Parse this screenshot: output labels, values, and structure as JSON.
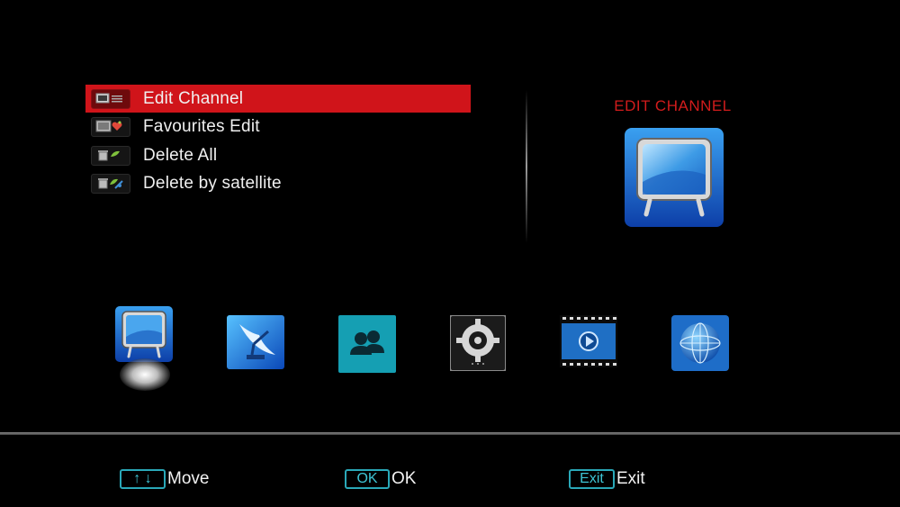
{
  "menu": {
    "items": [
      {
        "label": "Edit Channel",
        "icon": "tv-list-icon",
        "selected": true
      },
      {
        "label": "Favourites Edit",
        "icon": "favourite-heart-icon",
        "selected": false
      },
      {
        "label": "Delete All",
        "icon": "trash-icon",
        "selected": false
      },
      {
        "label": "Delete by satellite",
        "icon": "trash-satellite-icon",
        "selected": false
      }
    ]
  },
  "preview": {
    "title": "EDIT CHANNEL",
    "icon": "tv-icon",
    "title_color": "#d21c1c"
  },
  "categories": [
    {
      "icon": "tv-icon",
      "active": true
    },
    {
      "icon": "satellite-dish-icon",
      "active": false
    },
    {
      "icon": "users-icon",
      "active": false
    },
    {
      "icon": "gear-settings-icon",
      "active": false
    },
    {
      "icon": "media-play-icon",
      "active": false
    },
    {
      "icon": "globe-network-icon",
      "active": false
    }
  ],
  "footer": {
    "move_key": "↑ ↓",
    "move_label": "Move",
    "ok_key": "OK",
    "ok_label": "OK",
    "exit_key": "Exit",
    "exit_label": "Exit"
  },
  "colors": {
    "selection": "#d0141a",
    "accent_key": "#2aa8b8",
    "background": "#000000"
  }
}
